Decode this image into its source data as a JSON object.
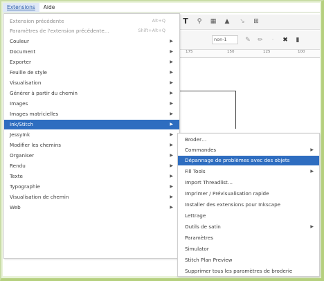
{
  "menubar": {
    "items": [
      {
        "label": "Extensions",
        "active": true
      },
      {
        "label": "Aide",
        "active": false
      }
    ]
  },
  "toolbar": {
    "icons": [
      "text-tool-icon",
      "zoom-icon",
      "node-icon",
      "bucket-icon",
      "arrow-icon",
      "crop-icon"
    ],
    "select_1": "non-1",
    "ruler_ticks": [
      "175",
      "150",
      "125",
      "100"
    ]
  },
  "menu": {
    "items": [
      {
        "label": "Extension précédente",
        "shortcut": "Alt+Q",
        "disabled": true,
        "arrow": false
      },
      {
        "label": "Paramètres de l'extension précédente…",
        "shortcut": "Shift+Alt+Q",
        "disabled": true,
        "arrow": false
      },
      {
        "label": "Couleur",
        "arrow": true
      },
      {
        "label": "Document",
        "arrow": true
      },
      {
        "label": "Exporter",
        "arrow": true
      },
      {
        "label": "Feuille de style",
        "arrow": true
      },
      {
        "label": "Visualisation",
        "arrow": true
      },
      {
        "label": "Générer à partir du chemin",
        "arrow": true
      },
      {
        "label": "Images",
        "arrow": true
      },
      {
        "label": "Images matricielles",
        "arrow": true
      },
      {
        "label": "Ink/Stitch",
        "arrow": true,
        "highlight": true
      },
      {
        "label": "JessyInk",
        "arrow": true
      },
      {
        "label": "Modifier les chemins",
        "arrow": true
      },
      {
        "label": "Organiser",
        "arrow": true
      },
      {
        "label": "Rendu",
        "arrow": true
      },
      {
        "label": "Texte",
        "arrow": true
      },
      {
        "label": "Typographie",
        "arrow": true
      },
      {
        "label": "Visualisation de chemin",
        "arrow": true
      },
      {
        "label": "Web",
        "arrow": true
      }
    ]
  },
  "submenu": {
    "items": [
      {
        "label": "Broder…",
        "arrow": false
      },
      {
        "label": "Commandes",
        "arrow": true
      },
      {
        "label": "Dépannage de problèmes avec des objets",
        "arrow": false,
        "highlight": true
      },
      {
        "label": "Fill Tools",
        "arrow": true
      },
      {
        "label": "Import Threadlist…",
        "arrow": false
      },
      {
        "label": "Imprimer / Prévisualisation rapide",
        "arrow": false
      },
      {
        "label": "Installer des extensions pour Inkscape",
        "arrow": false
      },
      {
        "label": "Lettrage",
        "arrow": false
      },
      {
        "label": "Outils de satin",
        "arrow": true
      },
      {
        "label": "Paramètres",
        "arrow": false
      },
      {
        "label": "Simulator",
        "arrow": false
      },
      {
        "label": "Stitch Plan Preview",
        "arrow": false
      },
      {
        "label": "Supprimer tous les paramètres de broderie",
        "arrow": false
      }
    ]
  },
  "colors": {
    "highlight": "#2e6dc0",
    "frame_border": "#b5d07e",
    "background": "#e8f2d8"
  }
}
